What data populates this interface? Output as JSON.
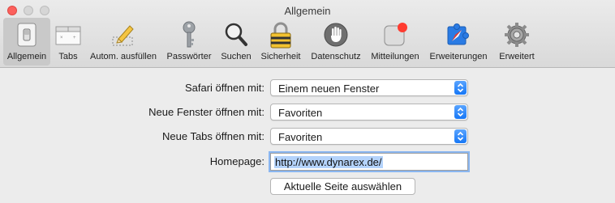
{
  "window": {
    "title": "Allgemein"
  },
  "toolbar": {
    "tabs": [
      {
        "label": "Allgemein",
        "icon": "general-switch-icon",
        "active": true
      },
      {
        "label": "Tabs",
        "icon": "tabs-icon",
        "active": false
      },
      {
        "label": "Autom. ausfüllen",
        "icon": "autofill-pencil-icon",
        "active": false
      },
      {
        "label": "Passwörter",
        "icon": "key-icon",
        "active": false
      },
      {
        "label": "Suchen",
        "icon": "magnifier-icon",
        "active": false
      },
      {
        "label": "Sicherheit",
        "icon": "padlock-icon",
        "active": false
      },
      {
        "label": "Datenschutz",
        "icon": "hand-icon",
        "active": false
      },
      {
        "label": "Mitteilungen",
        "icon": "notification-badge-icon",
        "active": false
      },
      {
        "label": "Erweiterungen",
        "icon": "puzzle-compass-icon",
        "active": false
      },
      {
        "label": "Erweitert",
        "icon": "gear-icon",
        "active": false
      }
    ]
  },
  "form": {
    "safari_open": {
      "label": "Safari öffnen mit:",
      "value": "Einem neuen Fenster"
    },
    "new_windows": {
      "label": "Neue Fenster öffnen mit:",
      "value": "Favoriten"
    },
    "new_tabs": {
      "label": "Neue Tabs öffnen mit:",
      "value": "Favoriten"
    },
    "homepage": {
      "label": "Homepage:",
      "value": "http://www.dynarex.de/"
    },
    "set_current_button": "Aktuelle Seite auswählen"
  },
  "colors": {
    "accent": "#1677f6",
    "selection": "#b4d3fb",
    "close": "#fc605c",
    "notification_dot": "#ff3b30"
  }
}
